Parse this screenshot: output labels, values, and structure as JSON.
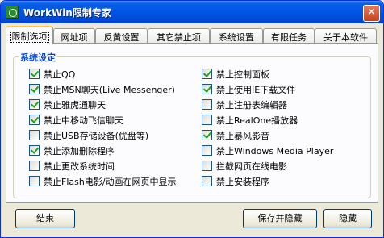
{
  "window": {
    "title": "WorkWin限制专家"
  },
  "tabs": [
    {
      "label": "限制选项",
      "active": true
    },
    {
      "label": "网址项"
    },
    {
      "label": "反黄设置"
    },
    {
      "label": "其它禁止项"
    },
    {
      "label": "系统设置"
    },
    {
      "label": "有限任务"
    },
    {
      "label": "关于本软件"
    }
  ],
  "group": {
    "title": "系统设定",
    "left": [
      {
        "label": "禁止QQ",
        "checked": true
      },
      {
        "label": "禁止MSN聊天(Live Messenger)",
        "checked": true
      },
      {
        "label": "禁止雅虎通聊天",
        "checked": true
      },
      {
        "label": "禁止中移动飞信聊天",
        "checked": true
      },
      {
        "label": "禁止USB存储设备(优盘等)",
        "checked": false
      },
      {
        "label": "禁止添加删除程序",
        "checked": true
      },
      {
        "label": "禁止更改系统时间",
        "checked": false
      },
      {
        "label": "禁止Flash电影/动画在网页中显示",
        "checked": false
      }
    ],
    "right": [
      {
        "label": "禁止控制面板",
        "checked": true
      },
      {
        "label": "禁止使用IE下载文件",
        "checked": true
      },
      {
        "label": "禁止注册表编辑器",
        "checked": false
      },
      {
        "label": "禁止RealOne播放器",
        "checked": false
      },
      {
        "label": "禁止暴风影音",
        "checked": true
      },
      {
        "label": "禁止Windows Media Player",
        "checked": false
      },
      {
        "label": "拦截网页在线电影",
        "checked": false
      },
      {
        "label": "禁止安装程序",
        "checked": false
      }
    ]
  },
  "buttons": {
    "end": "结束",
    "save_hide": "保存并隐藏",
    "hide": "隐藏"
  }
}
